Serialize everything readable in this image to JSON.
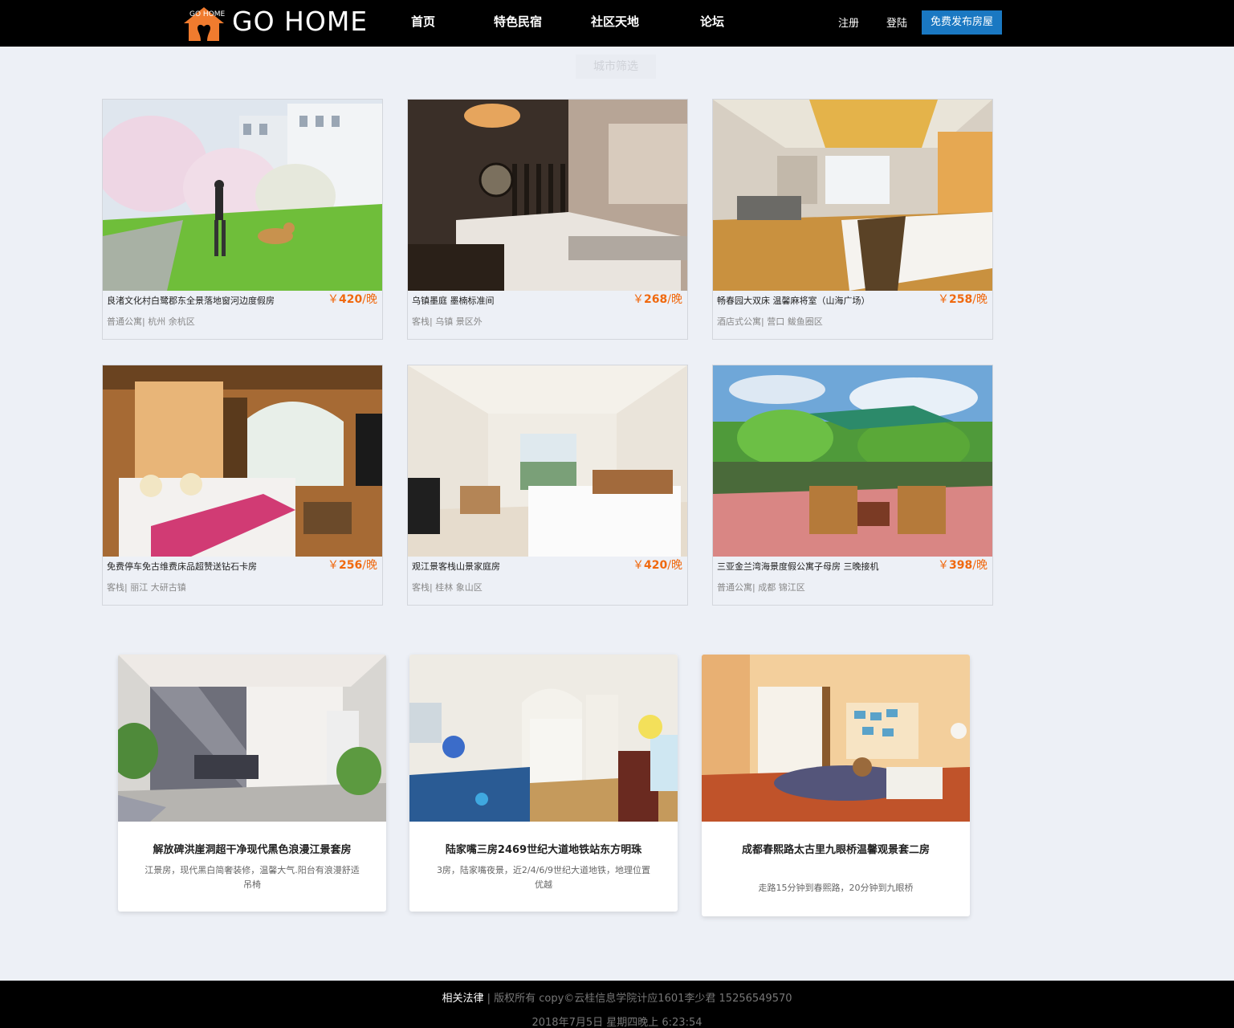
{
  "header": {
    "logo_tag": "GO HOME",
    "logo_text": "GO HOME",
    "nav": [
      "首页",
      "特色民宿",
      "社区天地",
      "论坛"
    ],
    "register": "注册",
    "login": "登陆",
    "publish": "免费发布房屋"
  },
  "filter_label": "城市筛选",
  "listings": [
    {
      "name": "良渚文化村白鹭郡东全景落地窗河边度假房",
      "price": "420",
      "unit": "/晚",
      "currency": "￥",
      "location": "普通公寓| 杭州 余杭区"
    },
    {
      "name": "乌镇墨庭 墨楠标准间",
      "price": "268",
      "unit": "/晚",
      "currency": "￥",
      "location": "客栈| 乌镇 景区外"
    },
    {
      "name": "畅春园大双床 温馨麻将室（山海广场）",
      "price": "258",
      "unit": "/晚",
      "currency": "￥",
      "location": "酒店式公寓| 营口 鲅鱼圈区"
    },
    {
      "name": "免费停车免古维费床品超赞送钻石卡房",
      "price": "256",
      "unit": "/晚",
      "currency": "￥",
      "location": "客栈| 丽江 大研古镇"
    },
    {
      "name": "观江景客栈山景家庭房",
      "price": "420",
      "unit": "/晚",
      "currency": "￥",
      "location": "客栈| 桂林 象山区"
    },
    {
      "name": "三亚金兰湾海景度假公寓子母房 三晚接机",
      "price": "398",
      "unit": "/晚",
      "currency": "￥",
      "location": "普通公寓| 成都 锦江区"
    }
  ],
  "features": [
    {
      "title": "解放碑洪崖洞超干净现代黑色浪漫江景套房",
      "desc": "江景房，现代黑白简奢装修，温馨大气.阳台有浪漫舒适吊椅"
    },
    {
      "title": "陆家嘴三房2469世纪大道地铁站东方明珠",
      "desc": "3房，陆家嘴夜景，近2/4/6/9世纪大道地铁，地理位置优越"
    },
    {
      "title": "成都春熙路太古里九眼桥温馨观景套二房",
      "desc": "走路15分钟到春熙路，20分钟到九眼桥"
    }
  ],
  "footer": {
    "law": "相关法律",
    "copyright": " | 版权所有 copy©云桂信息学院计应1601李少君 15256549570",
    "datetime": "2018年7月5日   星期四晚上  6:23:54"
  },
  "colors": {
    "accent": "#1a78c2",
    "price": "#f0690f",
    "logo": "#f07b2e"
  }
}
